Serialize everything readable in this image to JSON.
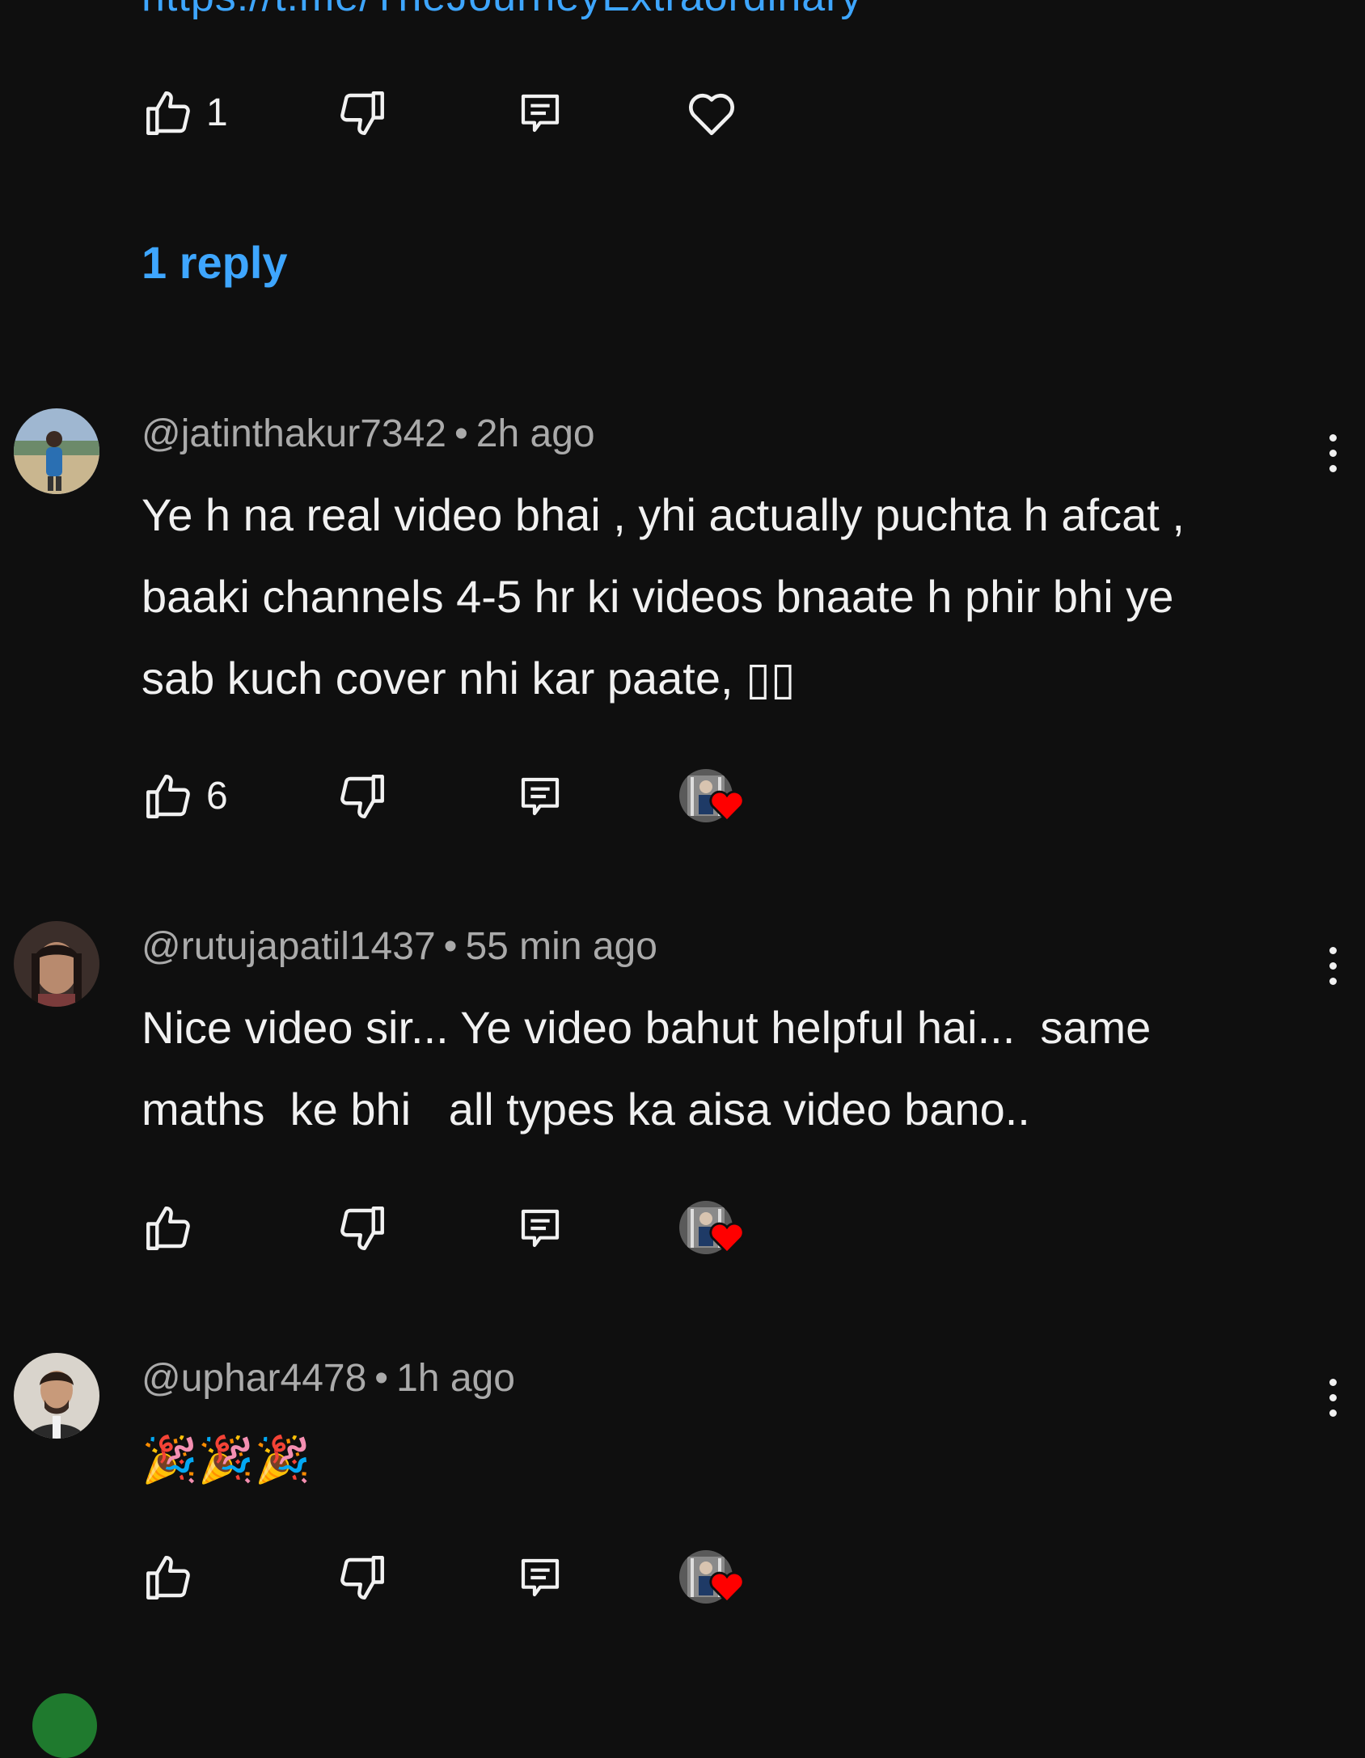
{
  "top_link": {
    "text": "https://t.me/TheJourneyExtraordinary"
  },
  "first_comment_actions": {
    "like_count": "1"
  },
  "replies": {
    "label": "1 reply"
  },
  "comments": [
    {
      "handle": "@jatinthakur7342",
      "separator": "•",
      "time": "2h ago",
      "text": "Ye h na real video bhai , yhi actually puchta h afcat ,\nbaaki channels 4-5 hr ki videos bnaate h phir bhi ye\nsab kuch cover nhi kar paate, ▯▯",
      "like_count": "6"
    },
    {
      "handle": "@rutujapatil1437",
      "separator": "•",
      "time": "55 min ago",
      "text": "Nice video sir... Ye video bahut helpful hai...  same\nmaths  ke bhi   all types ka aisa video bano..",
      "like_count": ""
    },
    {
      "handle": "@uphar4478",
      "separator": "•",
      "time": "1h ago",
      "text": "🎉🎉🎉",
      "like_count": ""
    }
  ],
  "icons": {
    "like": "thumbs-up-icon",
    "dislike": "thumbs-down-icon",
    "reply": "reply-icon",
    "heart": "heart-outline-icon",
    "creator_heart": "creator-heart-badge",
    "more": "more-vert-icon"
  },
  "colors": {
    "background": "#0f0f0f",
    "text": "#f1f1f1",
    "secondary_text": "#aaaaaa",
    "link": "#3ea6ff",
    "heart_red": "#ff0000"
  }
}
